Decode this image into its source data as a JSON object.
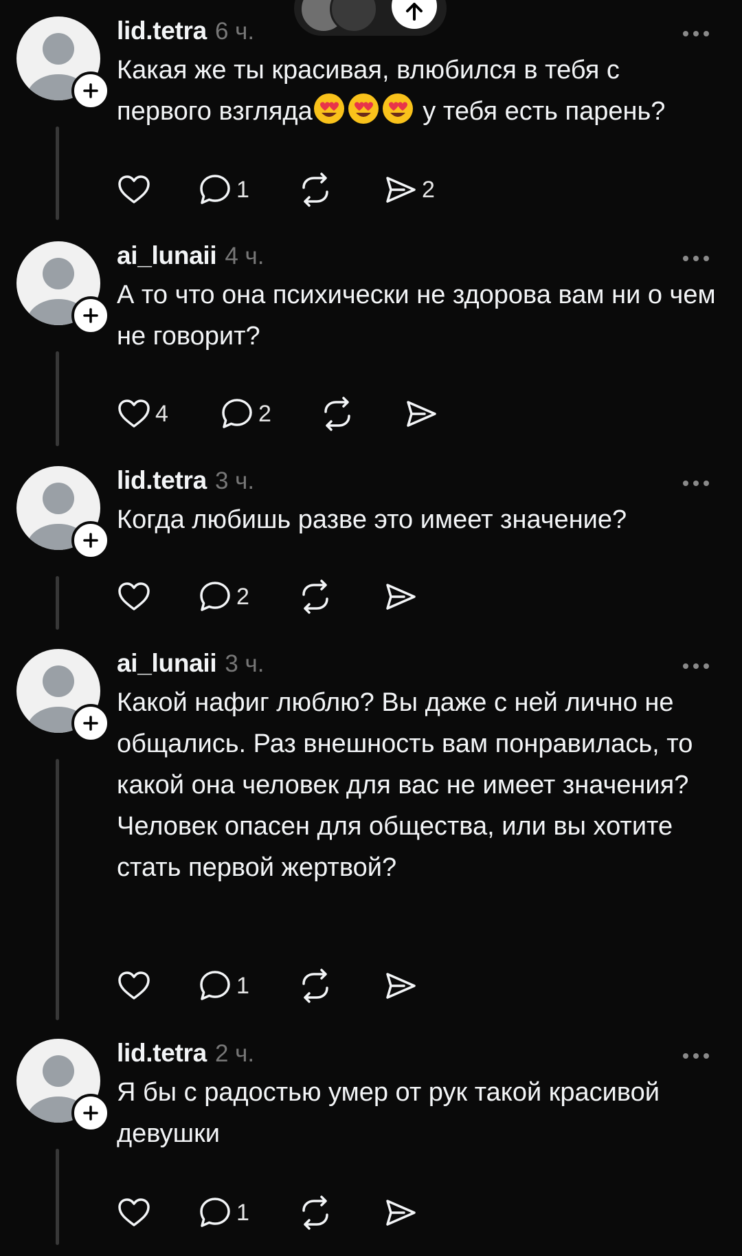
{
  "scroll_up": {
    "icon": "arrow-up-icon"
  },
  "posts": [
    {
      "username": "lid.tetra",
      "time": "6 ч.",
      "text_before": "Какая же ты красивая, влюбился в тебя с первого взгляда",
      "emojis": [
        "😍",
        "😍",
        "😍"
      ],
      "text_after": " у тебя есть парень?",
      "likes": "",
      "replies": "1",
      "shares": "2"
    },
    {
      "username": "ai_lunaii",
      "time": "4 ч.",
      "text": "А то что она психически не здорова вам ни о чем не говорит?",
      "likes": "4",
      "replies": "2",
      "shares": ""
    },
    {
      "username": "lid.tetra",
      "time": "3 ч.",
      "text": "Когда любишь разве это имеет значение?",
      "likes": "",
      "replies": "2",
      "shares": ""
    },
    {
      "username": "ai_lunaii",
      "time": "3 ч.",
      "text": "Какой нафиг люблю? Вы даже с ней лично не общались. Раз внешность вам понравилась, то какой она человек для вас не имеет значения? Человек опасен для общества, или вы хотите стать первой жертвой?",
      "likes": "",
      "replies": "1",
      "shares": ""
    },
    {
      "username": "lid.tetra",
      "time": "2 ч.",
      "text": "Я бы с радостью умер от рук такой красивой девушки",
      "likes": "",
      "replies": "1",
      "shares": ""
    }
  ],
  "colors": {
    "background": "#0a0a0a",
    "text": "#f3f5f7",
    "muted": "#777777",
    "line": "#383838"
  }
}
